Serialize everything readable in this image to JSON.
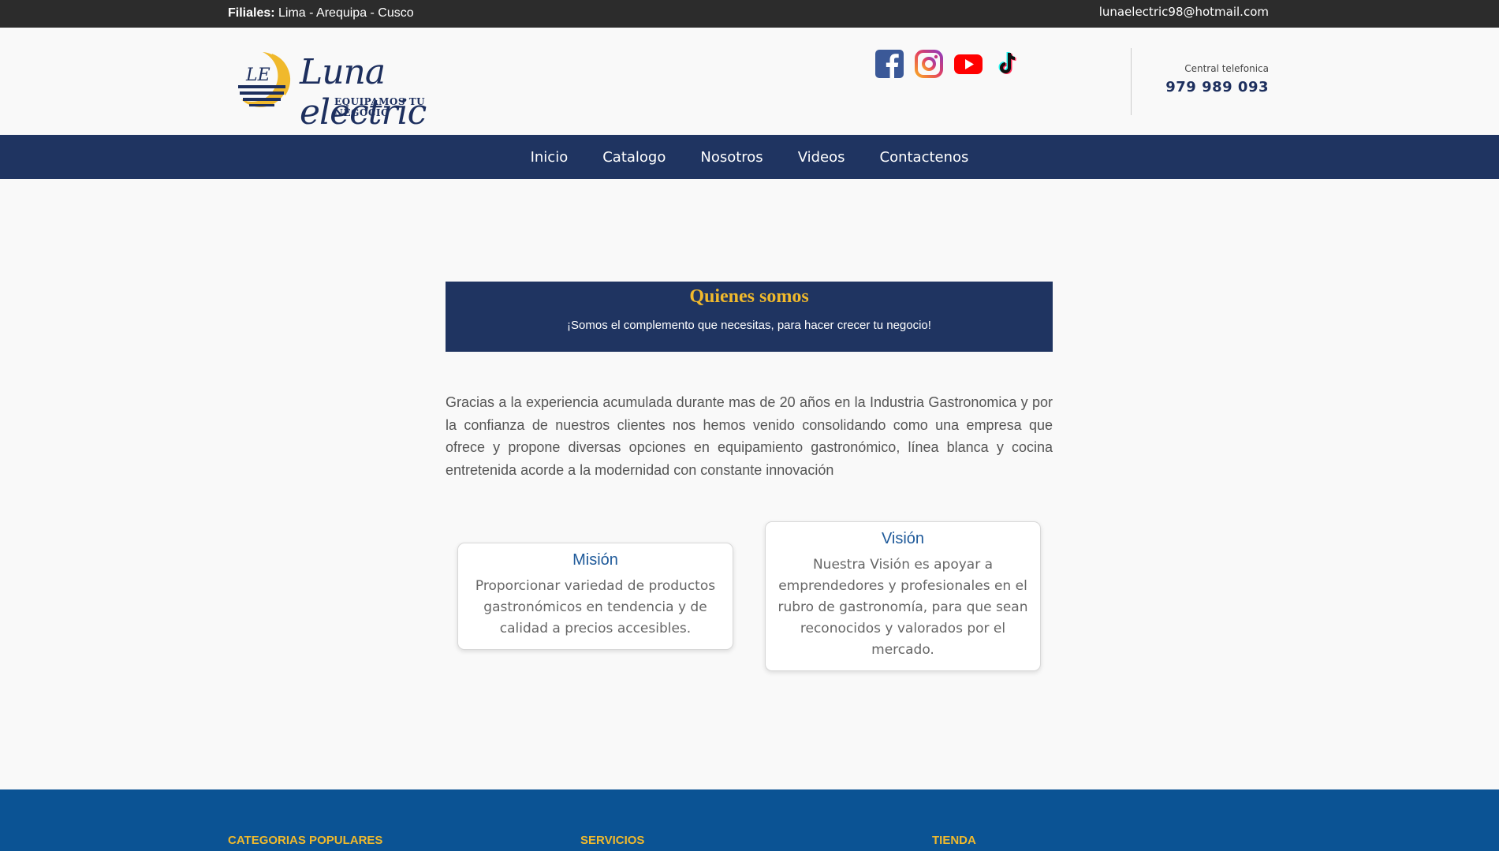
{
  "topbar": {
    "filiales_label": "Filiales:",
    "filiales_value": " Lima - Arequipa - Cusco",
    "email": "lunaelectric98@hotmail.com"
  },
  "header": {
    "brand_name": "Luna electric",
    "brand_tagline": "EQUIPAMOS TU NEGOCIO",
    "social": [
      "facebook-icon",
      "instagram-icon",
      "youtube-icon",
      "tiktok-icon"
    ],
    "phone_label": "Central telefonica",
    "phone_number": "979 989 093"
  },
  "nav": {
    "items": [
      {
        "label": "Inicio"
      },
      {
        "label": "Catalogo"
      },
      {
        "label": "Nosotros"
      },
      {
        "label": "Videos"
      },
      {
        "label": "Contactenos"
      }
    ]
  },
  "banner": {
    "title": "Quienes somos",
    "subtitle": "¡Somos el complemento que necesitas, para hacer crecer tu negocio!"
  },
  "intro": "Gracias a la experiencia acumulada durante mas de 20 años en la Industria Gastronomica y por la confianza de nuestros clientes nos hemos venido consolidando como una empresa que ofrece y propone diversas opciones en equipamiento gastronómico, línea blanca y cocina entretenida acorde a la modernidad con constante innovación",
  "mision": {
    "title": "Misión",
    "text": "Proporcionar variedad de productos gastronómicos en tendencia y de calidad a precios accesibles."
  },
  "vision": {
    "title": "Visión",
    "text": "Nuestra Visión es apoyar a emprendedores y profesionales en el rubro de gastronomía, para que sean reconocidos y valorados por el mercado."
  },
  "footer": {
    "col1": "CATEGORIAS POPULARES",
    "col2": "SERVICIOS",
    "col3": "TIENDA"
  },
  "colors": {
    "navy": "#1f3461",
    "gold": "#f0b92c",
    "footer_blue": "#0b5394"
  }
}
